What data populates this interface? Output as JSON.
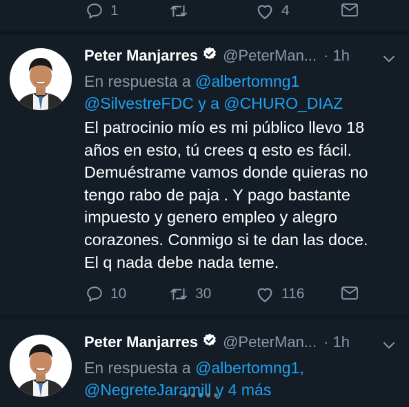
{
  "top_actions": {
    "reply_count": "1",
    "retweet_count": "",
    "like_count": "4"
  },
  "tweets": [
    {
      "name": "Peter Manjarres",
      "handle": "@PeterMan...",
      "separator": "·",
      "time": "1h",
      "reply_prefix": "En respuesta a",
      "reply_mention_1": "@albertomng1",
      "reply_mention_2": "@SilvestreFDC",
      "reply_joiner": "y a",
      "reply_mention_3": "@CHURO_DIAZ",
      "body_lines": [
        "El patrocinio mío es mi público llevo 18",
        "años en esto, tú crees q esto es fácil.",
        "Demuéstrame vamos donde quieras no",
        "tengo rabo de paja . Y pago bastante",
        "impuesto y genero empleo y alegro",
        "corazones. Conmigo si te dan las doce.",
        "El q nada debe nada teme."
      ],
      "reply_count": "10",
      "retweet_count": "30",
      "like_count": "116"
    },
    {
      "name": "Peter Manjarres",
      "handle": "@PeterMan...",
      "separator": "·",
      "time": "1h",
      "reply_prefix": "En respuesta a",
      "reply_mention_1": "@albertomng1,",
      "reply_mention_2": "@NegreteJaramill",
      "reply_joiner": "y 4 más"
    }
  ],
  "colors": {
    "background": "#141d26",
    "divider": "#10171e",
    "accent": "#1da1f2",
    "muted": "#8899a6"
  },
  "carousel": {
    "total": 5,
    "active_index": 2
  },
  "icons": [
    "reply-icon",
    "retweet-icon",
    "like-icon",
    "share-icon",
    "verified-icon",
    "chevron-down-icon"
  ]
}
